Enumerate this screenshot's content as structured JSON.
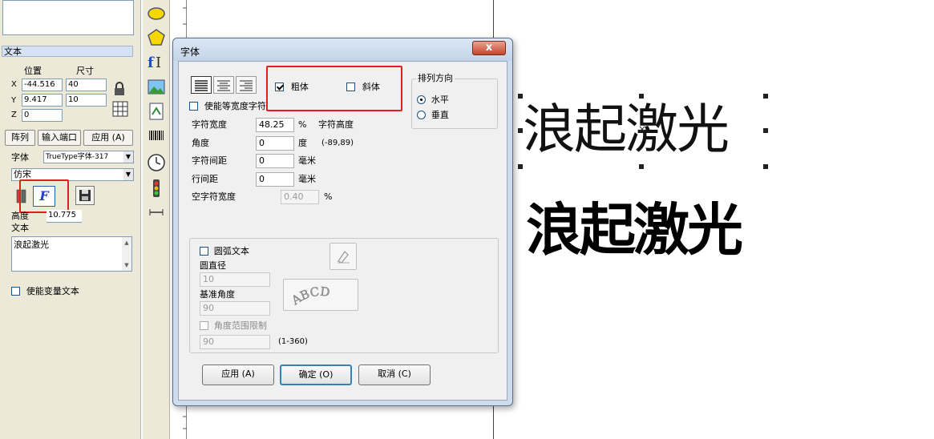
{
  "left_panel": {
    "section_title": "文本",
    "position_label": "位置",
    "size_label": "尺寸",
    "x_label": "X",
    "y_label": "Y",
    "z_label": "Z",
    "x_value": "-44.516",
    "y_value": "9.417",
    "z_value": "0",
    "width_value": "40",
    "height_value": "10",
    "array_button": "阵列",
    "input_port_button": "输入端口",
    "apply_button": "应用 (A)",
    "font_label": "字体",
    "font_type_value": "TrueType字体-317",
    "font_name_value": "仿宋",
    "height_label": "高度",
    "height_field_value": "10.775",
    "text_label": "文本",
    "text_content": "浪起激光",
    "enable_variable_text": "使能变量文本"
  },
  "dialog": {
    "title": "字体",
    "close_symbol": "x",
    "bold_label": "粗体",
    "italic_label": "斜体",
    "enable_equal_width": "使能等宽度字符",
    "direction_group": "排列方向",
    "horizontal_label": "水平",
    "vertical_label": "垂直",
    "char_width_label": "字符宽度",
    "char_width_value": "48.25",
    "char_width_unit": "%",
    "char_height_label": "字符高度",
    "angle_label": "角度",
    "angle_value": "0",
    "angle_unit": "度",
    "angle_range": "(-89,89)",
    "char_spacing_label": "字符间距",
    "char_spacing_value": "0",
    "char_spacing_unit": "毫米",
    "line_spacing_label": "行间距",
    "line_spacing_value": "0",
    "line_spacing_unit": "毫米",
    "space_width_label": "空字符宽度",
    "space_width_value": "0.40",
    "space_width_unit": "%",
    "arc_text_label": "圆弧文本",
    "radius_label": "圆直径",
    "radius_value": "10",
    "base_angle_label": "基准角度",
    "base_angle_value": "90",
    "angle_limit_label": "角度范围限制",
    "angle_limit_value": "90",
    "angle_limit_range": "(1-360)",
    "arc_preview_text": "ABCD",
    "apply_button": "应用 (A)",
    "ok_button": "确定 (O)",
    "cancel_button": "取消 (C)"
  },
  "canvas": {
    "text_regular": "浪起激光",
    "text_bold": "浪起激光"
  }
}
